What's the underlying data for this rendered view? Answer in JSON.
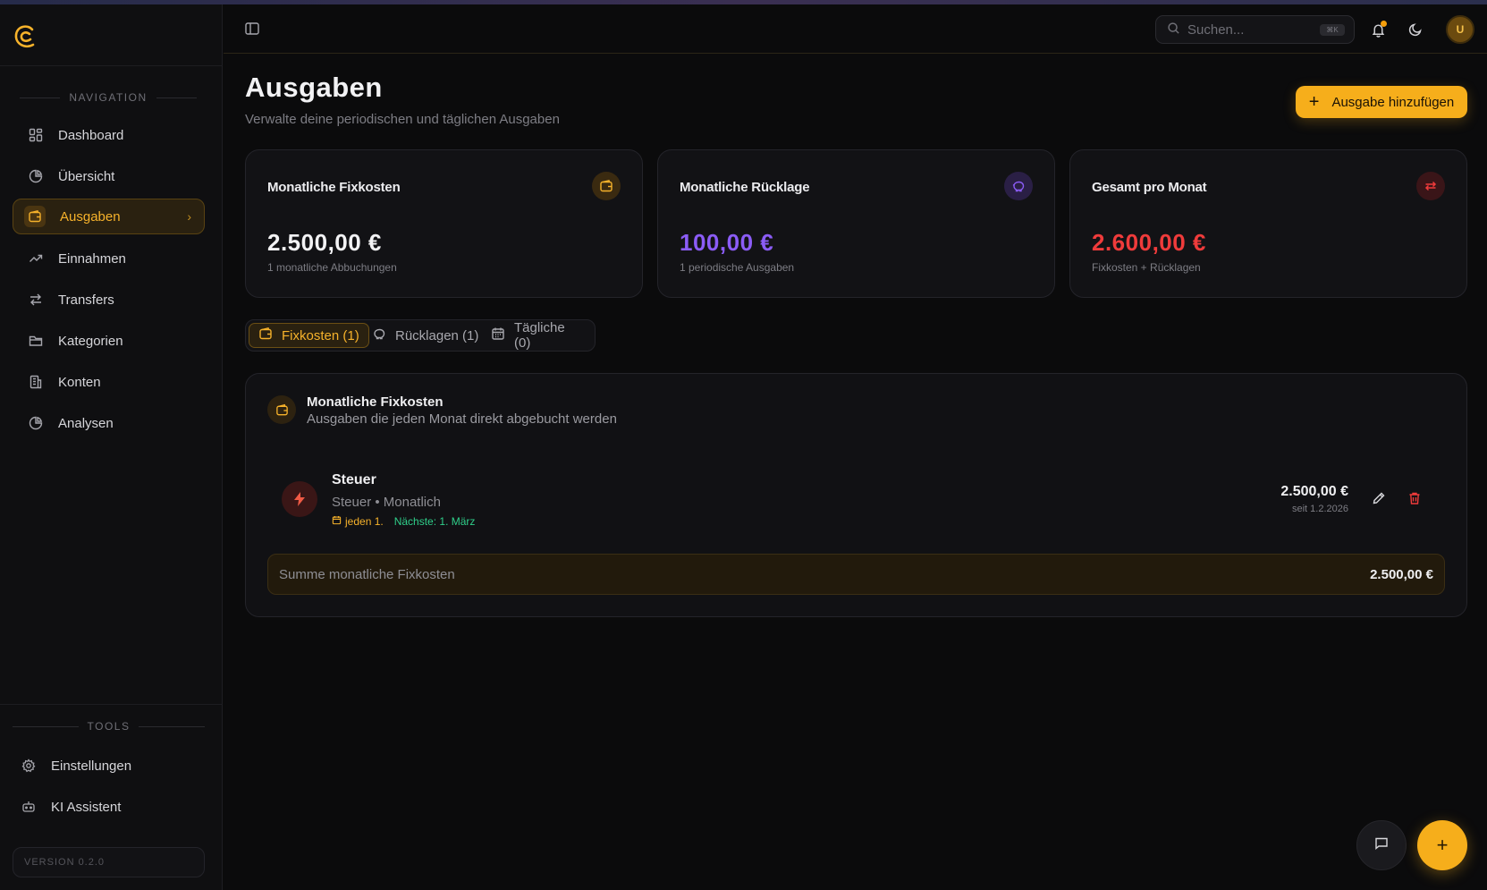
{
  "sidebar": {
    "nav_title": "NAVIGATION",
    "items": [
      {
        "label": "Dashboard",
        "icon": "grid-icon"
      },
      {
        "label": "Übersicht",
        "icon": "pie-icon"
      },
      {
        "label": "Ausgaben",
        "icon": "wallet-icon",
        "active": true
      },
      {
        "label": "Einnahmen",
        "icon": "trending-up-icon"
      },
      {
        "label": "Transfers",
        "icon": "arrows-icon"
      },
      {
        "label": "Kategorien",
        "icon": "folder-icon"
      },
      {
        "label": "Konten",
        "icon": "bank-icon"
      },
      {
        "label": "Analysen",
        "icon": "pie-icon"
      }
    ],
    "tools_title": "TOOLS",
    "tools": [
      {
        "label": "Einstellungen",
        "icon": "gear-icon"
      },
      {
        "label": "KI Assistent",
        "icon": "bot-icon"
      }
    ],
    "version": "VERSION 0.2.0"
  },
  "topbar": {
    "search_placeholder": "Suchen...",
    "search_shortcut": "⌘K",
    "avatar_initial": "U"
  },
  "page": {
    "title": "Ausgaben",
    "subtitle": "Verwalte deine periodischen und täglichen Ausgaben",
    "add_button": "Ausgabe hinzufügen"
  },
  "cards": [
    {
      "title": "Monatliche Fixkosten",
      "value": "2.500,00 €",
      "sub": "1 monatliche Abbuchungen",
      "color": "#f2f2f4",
      "badge_bg": "#3a2a10",
      "badge_color": "#f6b22b"
    },
    {
      "title": "Monatliche Rücklage",
      "value": "100,00 €",
      "sub": "1 periodische Ausgaben",
      "color": "#8b5cf6",
      "badge_bg": "#2a1f45",
      "badge_color": "#8b5cf6"
    },
    {
      "title": "Gesamt pro Monat",
      "value": "2.600,00 €",
      "sub": "Fixkosten + Rücklagen",
      "color": "#ef3b3b",
      "badge_bg": "#3a1518",
      "badge_color": "#ef3b3b"
    }
  ],
  "tabs": [
    {
      "label": "Fixkosten (1)",
      "active": true
    },
    {
      "label": "Rücklagen (1)"
    },
    {
      "label": "Tägliche (0)"
    }
  ],
  "list": {
    "title": "Monatliche Fixkosten",
    "subtitle": "Ausgaben die jeden Monat direkt abgebucht werden",
    "rows": [
      {
        "name": "Steuer",
        "meta": "Steuer • Monatlich",
        "schedule": "jeden 1.",
        "next": "Nächste: 1. März",
        "amount": "2.500,00 €",
        "since": "seit 1.2.2026"
      }
    ],
    "sum_label": "Summe monatliche Fixkosten",
    "sum_value": "2.500,00 €"
  },
  "fab": {
    "label": "+"
  }
}
